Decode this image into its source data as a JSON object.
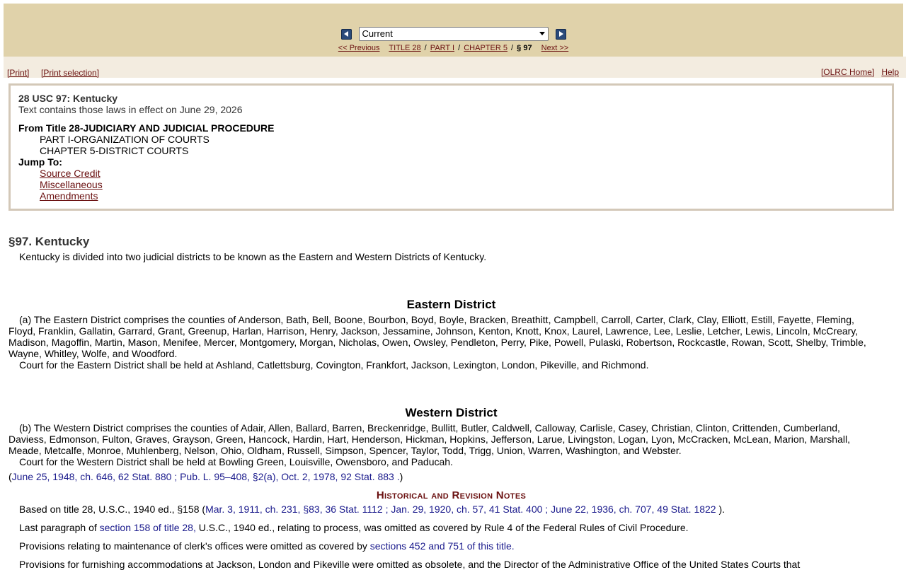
{
  "nav": {
    "select_value": "Current",
    "prev_link": "<< Previous",
    "title_link": "TITLE 28",
    "part_link": "PART I",
    "chapter_link": "CHAPTER 5",
    "current_section": "§ 97",
    "next_link": "Next >>",
    "sep": "/"
  },
  "toolbar": {
    "print": "[Print]",
    "print_selection": "[Print selection]",
    "home": "[OLRC Home]",
    "help": "Help"
  },
  "info": {
    "title": "28 USC 97: Kentucky",
    "effective": "Text contains those laws in effect on June 29, 2026",
    "from_title": "From Title 28-JUDICIARY AND JUDICIAL PROCEDURE",
    "part": "PART I-ORGANIZATION OF COURTS",
    "chapter": "CHAPTER 5-DISTRICT COURTS",
    "jump_label": "Jump To:",
    "jump_links": [
      "Source Credit",
      "Miscellaneous",
      "Amendments"
    ]
  },
  "section": {
    "heading": "§97. Kentucky",
    "intro": "Kentucky is divided into two judicial districts to be known as the Eastern and Western Districts of Kentucky.",
    "eastern": {
      "heading": "Eastern District",
      "lines": [
        "(a) The Eastern District comprises the counties of Anderson, Bath, Bell, Boone, Bourbon, Boyd, Boyle, Bracken, Breathitt, Campbell, Carroll, Carter, Clark, Clay, Elliott, Estill, Fayette, Fleming,",
        "Floyd, Franklin, Gallatin, Garrard, Grant, Greenup, Harlan, Harrison, Henry, Jackson, Jessamine, Johnson, Kenton, Knott, Knox, Laurel, Lawrence, Lee, Leslie, Letcher, Lewis, Lincoln, McCreary,",
        "Madison, Magoffin, Martin, Mason, Menifee, Mercer, Montgomery, Morgan, Nicholas, Owen, Owsley, Pendleton, Perry, Pike, Powell, Pulaski, Robertson, Rockcastle, Rowan, Scott, Shelby, Trimble,",
        "Wayne, Whitley, Wolfe, and Woodford."
      ],
      "court": "Court for the Eastern District shall be held at Ashland, Catlettsburg, Covington, Frankfort, Jackson, Lexington, London, Pikeville, and Richmond."
    },
    "western": {
      "heading": "Western District",
      "lines": [
        "(b) The Western District comprises the counties of Adair, Allen, Ballard, Barren, Breckenridge, Bullitt, Butler, Caldwell, Calloway, Carlisle, Casey, Christian, Clinton, Crittenden, Cumberland,",
        "Daviess, Edmonson, Fulton, Graves, Grayson, Green, Hancock, Hardin, Hart, Henderson, Hickman, Hopkins, Jefferson, Larue, Livingston, Logan, Lyon, McCracken, McLean, Marion, Marshall,",
        "Meade, Metcalfe, Monroe, Muhlenberg, Nelson, Ohio, Oldham, Russell, Simpson, Spencer, Taylor, Todd, Trigg, Union, Warren, Washington, and Webster."
      ],
      "court": "Court for the Western District shall be held at Bowling Green, Louisville, Owensboro, and Paducah."
    },
    "source_credit": {
      "open": "(",
      "link": "June 25, 1948, ch. 646, 62 Stat. 880 ; Pub. L. 95–408, §2(a), Oct. 2, 1978, 92 Stat. 883 .",
      "close": ")"
    }
  },
  "notes": {
    "heading": "Historical and Revision Notes",
    "p1_prefix": "Based on title 28, U.S.C., 1940 ed., §158 (",
    "p1_link": "Mar. 3, 1911, ch. 231, §83, 36 Stat. 1112 ; Jan. 29, 1920, ch. 57, 41 Stat. 400 ; June 22, 1936, ch. 707, 49 Stat. 1822 ",
    "p1_suffix": ").",
    "p2_prefix": "Last paragraph of ",
    "p2_link": "section 158 of title 28,",
    "p2_suffix": " U.S.C., 1940 ed., relating to process, was omitted as covered by Rule 4 of the Federal Rules of Civil Procedure.",
    "p3_prefix": "Provisions relating to maintenance of clerk's offices were omitted as covered by ",
    "p3_link": "sections 452 and 751 of this title.",
    "p4_partial": "Provisions for furnishing accommodations at Jackson, London and Pikeville were omitted as obsolete, and the Director of the Administrative Office of the United States Courts that"
  }
}
